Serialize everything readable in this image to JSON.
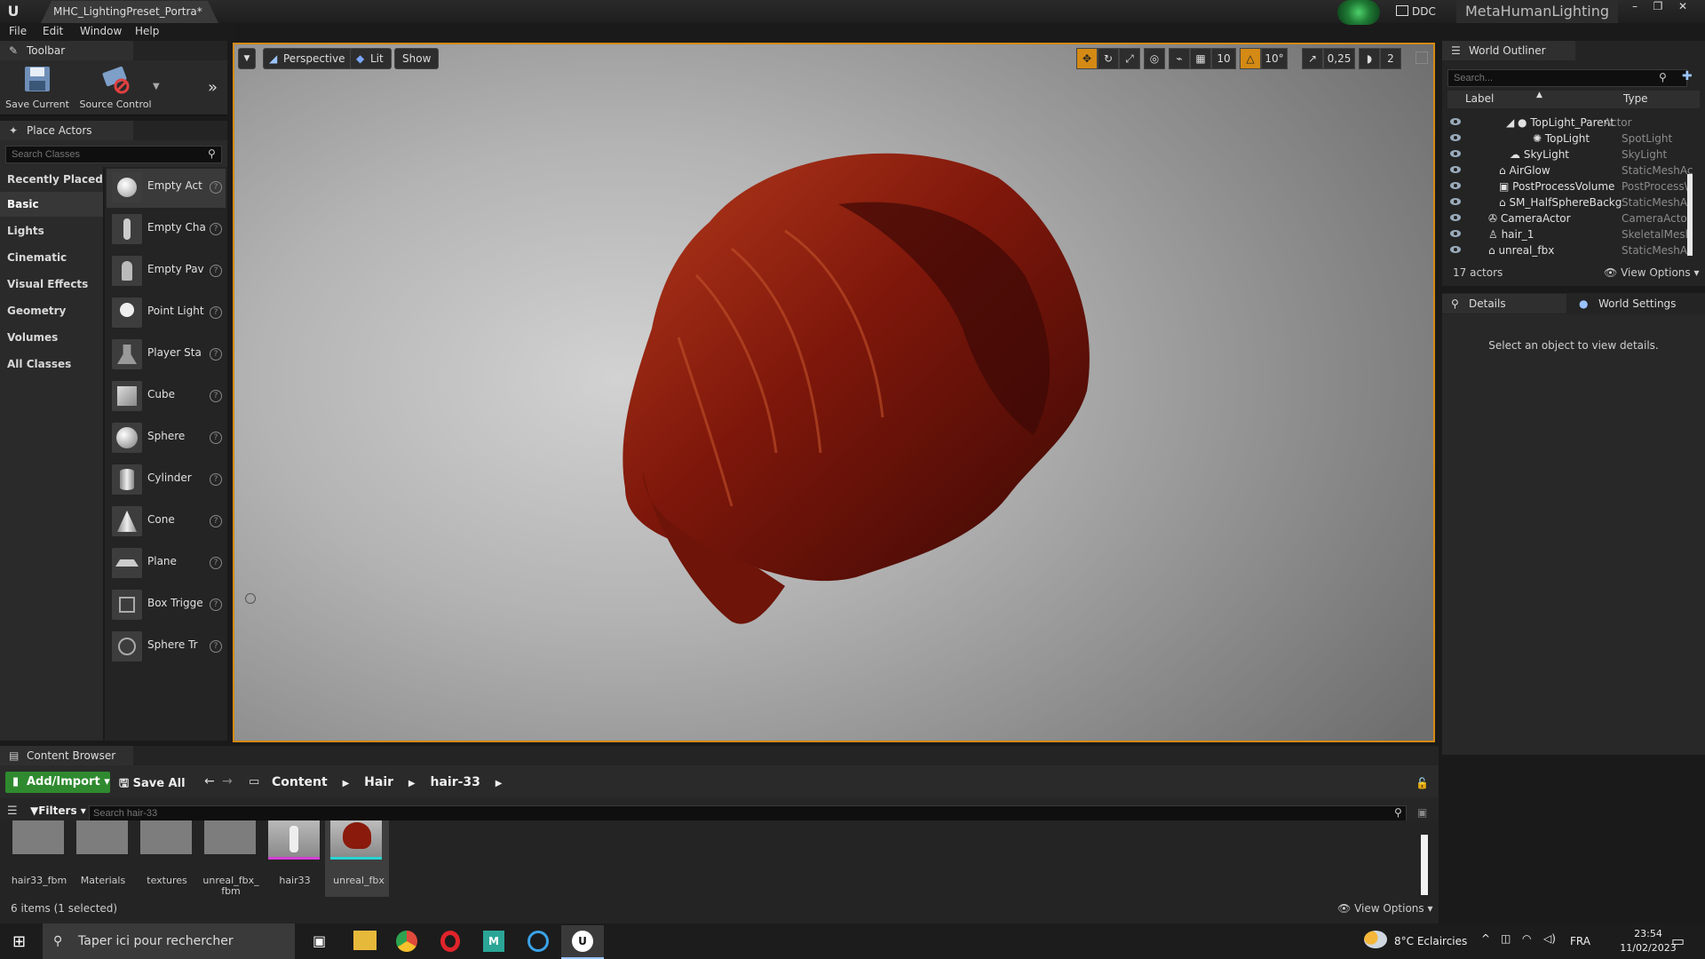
{
  "window": {
    "tab_title": "MHC_LightingPreset_Portra*",
    "status_text": "DDC",
    "app_name": "MetaHumanLighting"
  },
  "menu": [
    "File",
    "Edit",
    "Window",
    "Help"
  ],
  "toolbar": {
    "tab_label": "Toolbar",
    "save_current_label": "Save Current",
    "source_control_label": "Source Control"
  },
  "place_actors": {
    "tab_label": "Place Actors",
    "search_placeholder": "Search Classes",
    "categories": [
      "Recently Placed",
      "Basic",
      "Lights",
      "Cinematic",
      "Visual Effects",
      "Geometry",
      "Volumes",
      "All Classes"
    ],
    "selected_category": "Basic",
    "items": [
      "Empty Act",
      "Empty Cha",
      "Empty Pav",
      "Point Light",
      "Player Sta",
      "Cube",
      "Sphere",
      "Cylinder",
      "Cone",
      "Plane",
      "Box Trigge",
      "Sphere Tr"
    ]
  },
  "viewport": {
    "perspective_label": "Perspective",
    "lit_label": "Lit",
    "show_label": "Show",
    "grid_snap": "10",
    "rotation_snap": "10°",
    "scale_snap": "0,25",
    "camera_speed": "2"
  },
  "world_outliner": {
    "tab_label": "World Outliner",
    "search_placeholder": "Search...",
    "col_label": "Label",
    "col_type": "Type",
    "rows": [
      {
        "label": "TopLight_Parent",
        "type": "Actor"
      },
      {
        "label": "TopLight",
        "type": "SpotLight"
      },
      {
        "label": "SkyLight",
        "type": "SkyLight"
      },
      {
        "label": "AirGlow",
        "type": "StaticMeshAc"
      },
      {
        "label": "PostProcessVolume",
        "type": "PostProcess\\"
      },
      {
        "label": "SM_HalfSphereBackg",
        "type": "StaticMeshAc"
      },
      {
        "label": "CameraActor",
        "type": "CameraActor"
      },
      {
        "label": "hair_1",
        "type": "SkeletalMesh"
      },
      {
        "label": "unreal_fbx",
        "type": "StaticMeshAc"
      }
    ],
    "actor_count": "17 actors",
    "view_options": "View Options"
  },
  "details": {
    "tab_details": "Details",
    "tab_world_settings": "World Settings",
    "empty_message": "Select an object to view details."
  },
  "content_browser": {
    "tab_label": "Content Browser",
    "add_import": "Add/Import",
    "save_all": "Save All",
    "breadcrumb": [
      "Content",
      "Hair",
      "hair-33"
    ],
    "filters_label": "Filters",
    "search_placeholder": "Search hair-33",
    "assets": [
      "hair33_fbm",
      "Materials",
      "textures",
      "unreal_fbx_ fbm",
      "hair33",
      "unreal_fbx"
    ],
    "status": "6 items (1 selected)",
    "view_options": "View Options"
  },
  "taskbar": {
    "search_text": "Taper ici pour rechercher",
    "weather": "8°C  Eclaircies",
    "language": "FRA",
    "time": "23:54",
    "date": "11/02/2023"
  },
  "colors": {
    "accent_orange": "#d48a14",
    "add_import_green": "#2f8a2f",
    "hair": "#8a1a0c"
  }
}
